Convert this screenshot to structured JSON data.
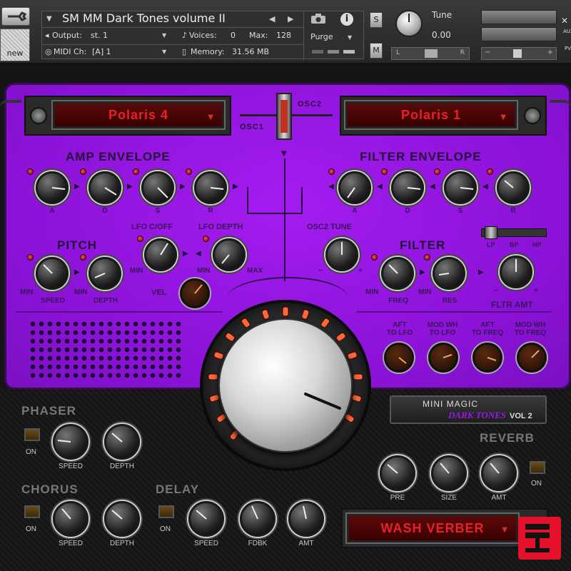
{
  "header": {
    "instrument_name": "SM MM Dark Tones volume  II",
    "output_label": "Output:",
    "output_value": "st. 1",
    "voices_label": "Voices:",
    "voices_value": "0",
    "max_label": "Max:",
    "max_value": "128",
    "purge_label": "Purge",
    "midi_label": "MIDI Ch:",
    "midi_value": "[A]  1",
    "memory_label": "Memory:",
    "memory_value": "31.56 MB",
    "tune_label": "Tune",
    "tune_value": "0.00",
    "solo_label": "S",
    "mute_label": "M",
    "pan_left": "L",
    "pan_right": "R",
    "vol_minus": "−",
    "vol_plus": "+",
    "new_label": "new",
    "aux_label": "AUX",
    "pv_label": "PV"
  },
  "osc": {
    "osc1_preset": "Polaris 4",
    "osc2_preset": "Polaris 1",
    "osc1_label": "OSC1",
    "osc2_label": "OSC2"
  },
  "amp_env": {
    "title": "AMP ENVELOPE",
    "labels": [
      "A",
      "D",
      "S",
      "R"
    ]
  },
  "filter_env": {
    "title": "FILTER ENVELOPE",
    "labels": [
      "A",
      "D",
      "S",
      "R"
    ]
  },
  "pitch": {
    "title": "PITCH",
    "speed_label": "SPEED",
    "depth_label": "DEPTH",
    "min1": "MIN",
    "min2": "MIN"
  },
  "lfo": {
    "cutoff_label": "LFO C/OFF",
    "depth_label": "LFO DEPTH",
    "min1": "MIN",
    "min2": "MIN",
    "max": "MAX",
    "vel_label": "VEL"
  },
  "osc2_tune": {
    "label": "OSC2 TUNE",
    "minus": "−",
    "plus": "+"
  },
  "filter": {
    "title": "FILTER",
    "freq_label": "FREQ",
    "res_label": "RES",
    "min1": "MIN",
    "min2": "MIN",
    "type_lp": "LP",
    "type_bp": "BP",
    "type_hp": "HP",
    "amt_label": "FLTR AMT",
    "amt_minus": "−",
    "amt_plus": "+"
  },
  "mod": {
    "labels": [
      "AFT\nTO LFO",
      "MOD WH\nTO LFO",
      "AFT\nTO FREQ",
      "MOD WH\nTO FREQ"
    ]
  },
  "phaser": {
    "title": "PHASER",
    "on": "ON",
    "speed": "SPEED",
    "depth": "DEPTH"
  },
  "chorus": {
    "title": "CHORUS",
    "on": "ON",
    "speed": "SPEED",
    "depth": "DEPTH"
  },
  "delay": {
    "title": "DELAY",
    "on": "ON",
    "speed": "SPEED",
    "fdbk": "FDBK",
    "amt": "AMT"
  },
  "reverb": {
    "title": "REVERB",
    "on": "ON",
    "pre": "PRE",
    "size": "SIZE",
    "amt": "AMT",
    "preset": "WASH VERBER"
  },
  "logo": {
    "line1": "MINI MAGIC",
    "line2": "DARK TONES",
    "line3": "VOL 2"
  },
  "colors": {
    "accent_purple": "#9a18e6",
    "display_red": "#e8202a"
  }
}
